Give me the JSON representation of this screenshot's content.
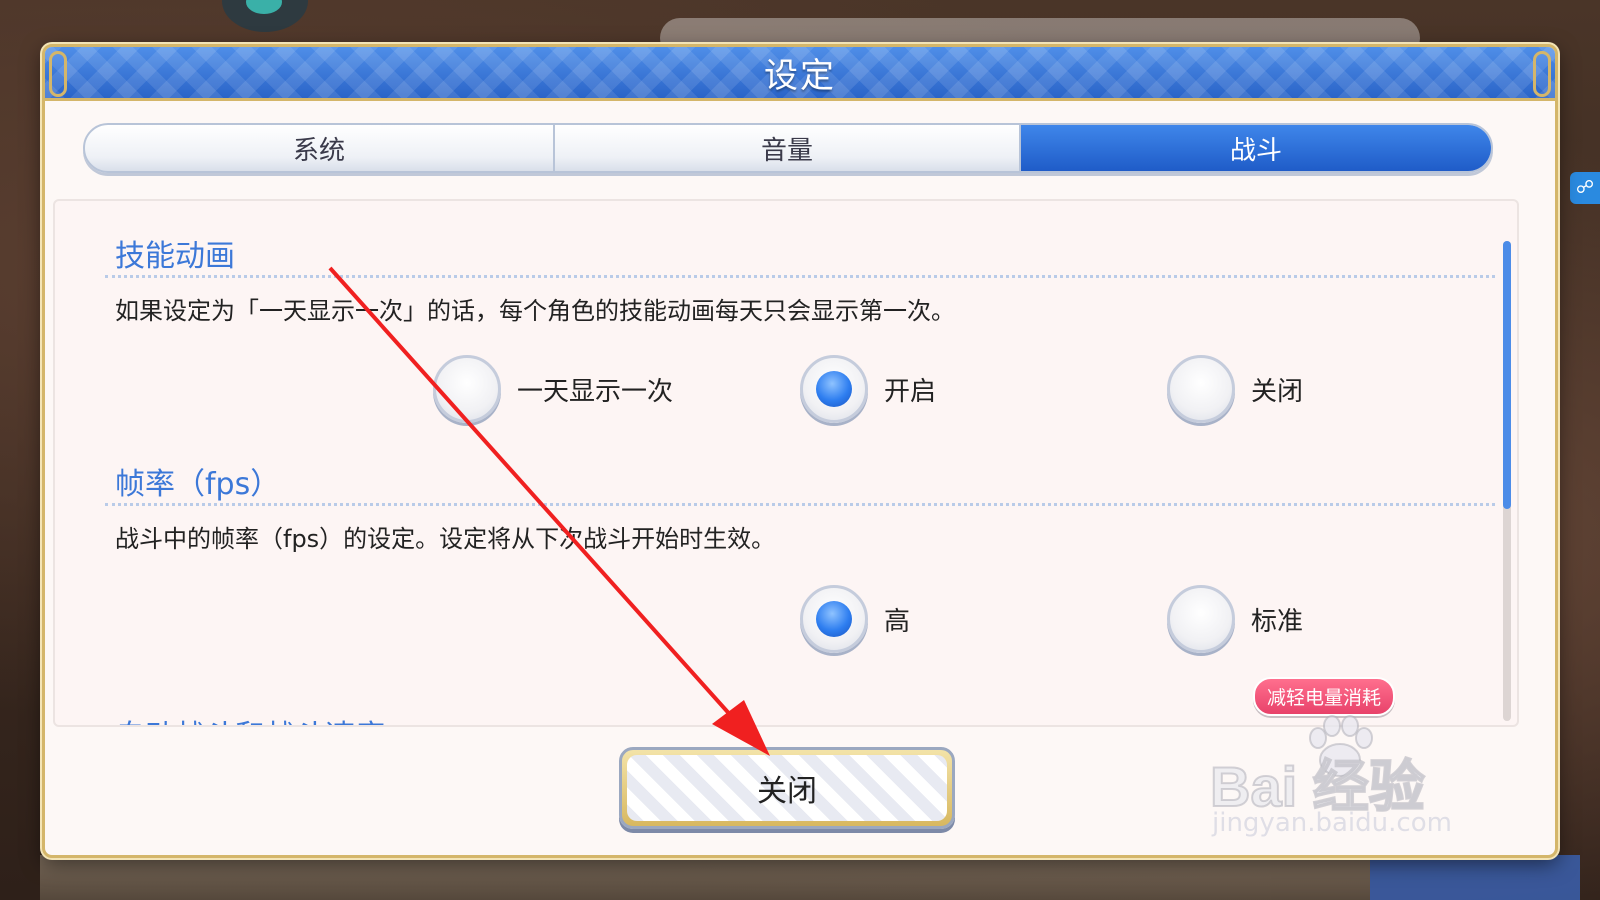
{
  "dialog": {
    "title": "设定",
    "tabs": [
      {
        "label": "系统",
        "active": false
      },
      {
        "label": "音量",
        "active": false
      },
      {
        "label": "战斗",
        "active": true
      }
    ],
    "close_button": "关闭"
  },
  "sections": {
    "skill_animation": {
      "title": "技能动画",
      "description": "如果设定为「一天显示一次」的话，每个角色的技能动画每天只会显示第一次。",
      "options": [
        {
          "label": "一天显示一次",
          "selected": false
        },
        {
          "label": "开启",
          "selected": true
        },
        {
          "label": "关闭",
          "selected": false
        }
      ]
    },
    "frame_rate": {
      "title": "帧率（fps）",
      "description": "战斗中的帧率（fps）的设定。设定将从下次战斗开始时生效。",
      "options": [
        {
          "label": "高",
          "selected": true
        },
        {
          "label": "标准",
          "selected": false
        }
      ],
      "badge": "减轻电量消耗"
    },
    "next": {
      "title": "自动战斗和战斗速度"
    }
  },
  "watermark": {
    "brand": "Bai  经验",
    "url": "jingyan.baidu.com"
  },
  "colors": {
    "accent_blue": "#2a64c8",
    "section_title": "#3c78d8",
    "badge_pink": "#e8426a",
    "annotation_red": "#f02020"
  },
  "icons": {
    "side_tab": "cloud-link-icon",
    "paw": "baidu-paw-icon"
  }
}
